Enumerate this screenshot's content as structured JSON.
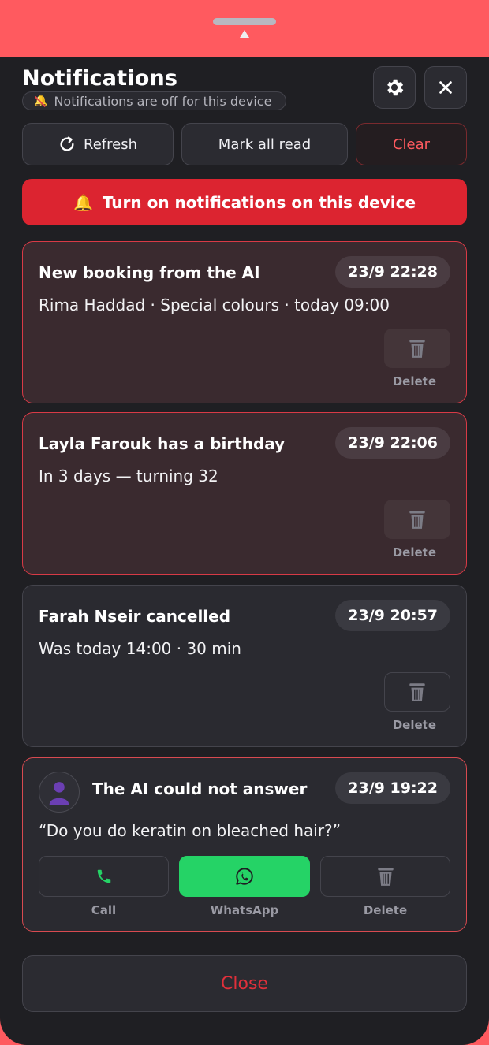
{
  "header": {
    "title": "Notifications",
    "status_text": "Notifications are off for this device",
    "settings_icon": "gear-icon",
    "close_icon": "close-icon"
  },
  "actions": {
    "refresh": "Refresh",
    "mark_all_read": "Mark all read",
    "clear": "Clear"
  },
  "enable_banner": {
    "label": "Turn on notifications on this device"
  },
  "notifications": [
    {
      "title": "New booking from the AI",
      "body": "Rima Haddad · Special colours · today 09:00",
      "time": "23/9 22:28",
      "unread": true,
      "delete_label": "Delete"
    },
    {
      "title": "Layla Farouk has a birthday",
      "body": "In 3 days — turning 32",
      "time": "23/9 22:06",
      "unread": true,
      "delete_label": "Delete"
    },
    {
      "title": "Farah Nseir cancelled",
      "body": "Was today 14:00 · 30 min",
      "time": "23/9 20:57",
      "unread": false,
      "delete_label": "Delete"
    },
    {
      "title": "The AI could not answer",
      "body": "“Do you do keratin on bleached hair?”",
      "time": "23/9 19:22",
      "unread": true,
      "actions": {
        "call": "Call",
        "whatsapp": "WhatsApp",
        "delete": "Delete"
      }
    }
  ],
  "footer": {
    "close_label": "Close"
  },
  "colors": {
    "accent_red": "#dc2430",
    "whatsapp_green": "#25d366",
    "sheet_background": "#1f1f23",
    "top_strip": "#ff5a5f"
  }
}
